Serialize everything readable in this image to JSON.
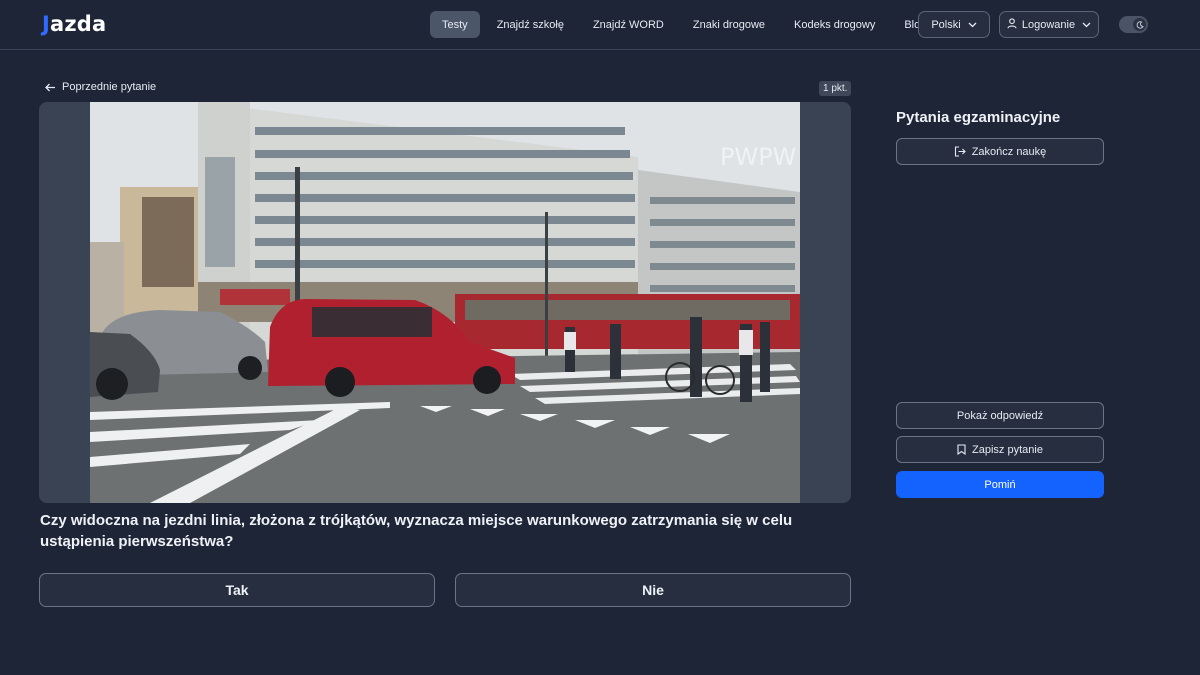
{
  "header": {
    "logo_j": "J",
    "logo_rest": "azda",
    "nav": [
      {
        "label": "Testy",
        "active": true
      },
      {
        "label": "Znajdź szkołę",
        "active": false
      },
      {
        "label": "Znajdź WORD",
        "active": false
      },
      {
        "label": "Znaki drogowe",
        "active": false
      },
      {
        "label": "Kodeks drogowy",
        "active": false
      },
      {
        "label": "Blog",
        "active": false
      }
    ],
    "language": "Polski",
    "login": "Logowanie",
    "theme_toggle_icon": "moon-icon"
  },
  "question_panel": {
    "back_label": "Poprzednie pytanie",
    "points": "1 pkt.",
    "photo_watermarks": [
      "PWPW"
    ],
    "question_text": "Czy widoczna na jezdni linia, złożona z trójkątów, wyznacza miejsce warunkowego zatrzymania się w celu ustąpienia pierwszeństwa?",
    "answers": {
      "yes": "Tak",
      "no": "Nie"
    }
  },
  "sidebar": {
    "title": "Pytania egzaminacyjne",
    "end_label": "Zakończ naukę",
    "show_answer_label": "Pokaż odpowiedź",
    "save_label": "Zapisz pytanie",
    "skip_label": "Pomiń"
  },
  "colors": {
    "background": "#1e2536",
    "accent_blue": "#1463ff",
    "nav_active": "#4b5669"
  }
}
